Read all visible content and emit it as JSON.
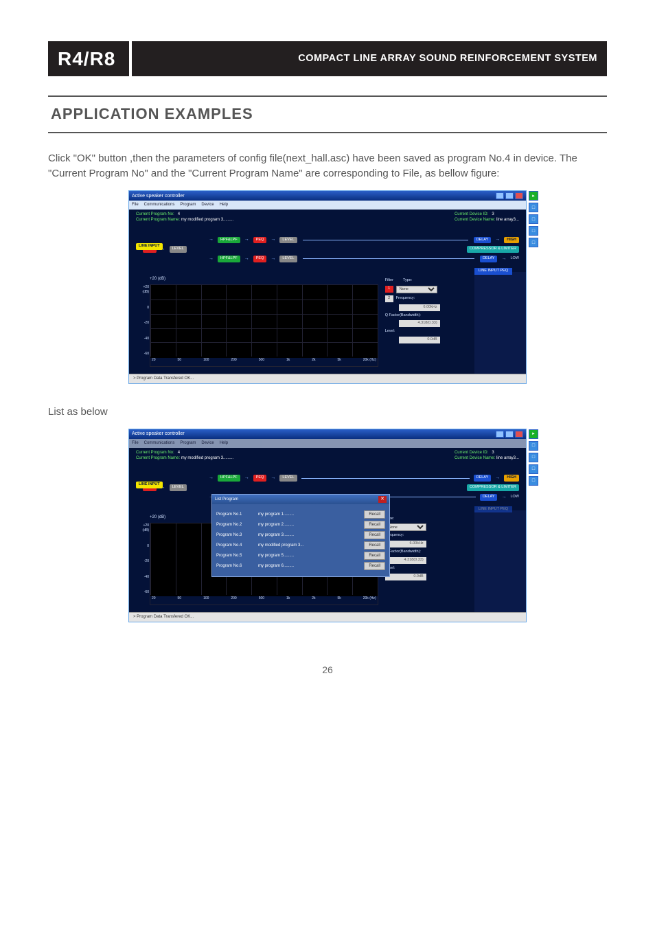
{
  "header": {
    "model": "R4/R8",
    "subtitle": "COMPACT LINE ARRAY SOUND REINFORCEMENT SYSTEM"
  },
  "section_title": "APPLICATION EXAMPLES",
  "body_text_1": "Click \"OK\" button ,then the parameters of config file(next_hall.asc) have been saved as program No.4 in device. The \"Current Program No\" and the \"Current Program Name\" are corresponding to File, as bellow figure:",
  "body_text_2": "List as below",
  "page_number": "26",
  "app": {
    "title": "Active speaker controller",
    "menu": [
      "File",
      "Communications",
      "Program",
      "Device",
      "Help"
    ],
    "info": {
      "curr_prog_no_label": "Current Program No:",
      "curr_prog_no": "4",
      "curr_prog_name_label": "Current Program Name:",
      "curr_prog_name": "my modified program 3.........",
      "curr_dev_id_label": "Current Device ID:",
      "curr_dev_id": "3",
      "curr_dev_name_label": "Current Device Name:",
      "curr_dev_name": "line array3..."
    },
    "flow": {
      "line_input": "LINE INPUT",
      "peq": "PEQ",
      "level": "LEVEL",
      "hpf_lpf": "HPF&LPF",
      "delay": "DELAY",
      "comp_lim": "COMPRESSOR & LIMITER",
      "high": "HIGH",
      "low": "LOW"
    },
    "panel_title": "LINE INPUT PEQ",
    "eq": {
      "title": "+20 (dB)",
      "yticks": [
        "+20 (dB)",
        "0",
        "-20",
        "-40",
        "-60"
      ],
      "xticks": [
        "20",
        "50",
        "100",
        "200",
        "500",
        "1k",
        "2k",
        "5k",
        "20k (Hz)"
      ],
      "filter_label": "Filter",
      "type_label": "Type:",
      "type_value": "None",
      "freq_label": "Frequency:",
      "freq_value": "6.00kHz",
      "q_label": "Q Factor(Bandwidth):",
      "q_value": "4.318(0.33)",
      "level_label": "Level:",
      "level_value": "0.0dB",
      "filter1": "1",
      "filter2": "2"
    },
    "status": "> Program Data Transfered OK...",
    "popup": {
      "title": "List Program",
      "recall": "Recall",
      "rows": [
        {
          "no": "Program No.1",
          "name": "my program 1........."
        },
        {
          "no": "Program No.2",
          "name": "my program 2........."
        },
        {
          "no": "Program No.3",
          "name": "my program 3........."
        },
        {
          "no": "Program No.4",
          "name": "my modified program 3..."
        },
        {
          "no": "Program No.5",
          "name": "my program 5........."
        },
        {
          "no": "Program No.6",
          "name": "my program 6........."
        }
      ]
    }
  }
}
